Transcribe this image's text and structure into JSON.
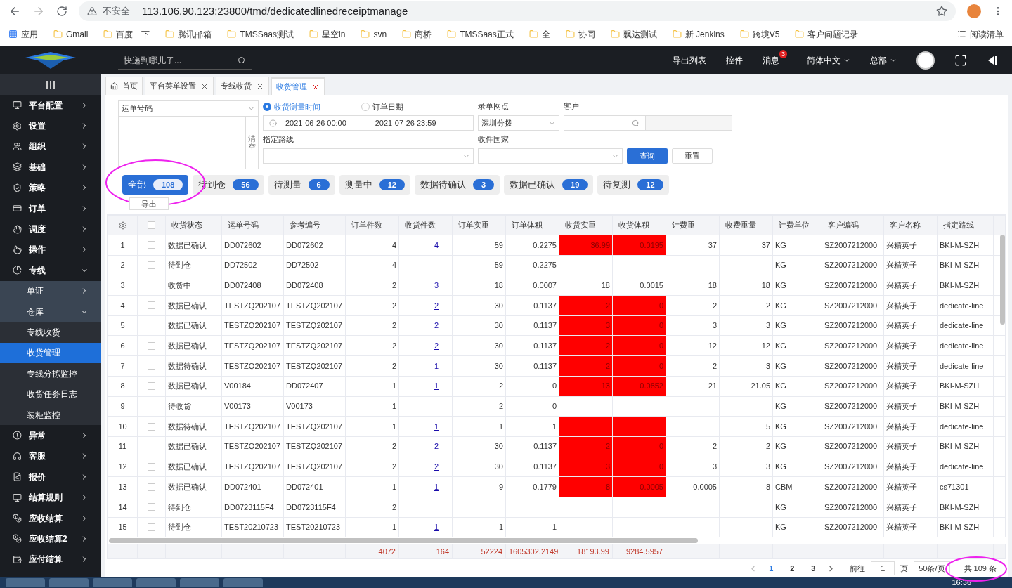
{
  "browser": {
    "security": "不安全",
    "url": "113.106.90.123:23800/tmd/dedicatedlinedreceiptmanage",
    "bookmarks": [
      "应用",
      "Gmail",
      "百度一下",
      "腾讯邮箱",
      "TMSSaas测试",
      "星空in",
      "svn",
      "商桥",
      "TMSSaas正式",
      "全",
      "协同",
      "飘达测试",
      "新 Jenkins",
      "跨境V5",
      "客户问题记录"
    ],
    "reading_list": "阅读清单"
  },
  "header": {
    "search_placeholder": "快递到哪儿了...",
    "actions": [
      "导出列表",
      "控件"
    ],
    "messages": "消息",
    "message_badge": "3",
    "language": "简体中文",
    "region": "总部"
  },
  "sidebar": {
    "items": [
      {
        "label": "平台配置",
        "expanded": false
      },
      {
        "label": "设置",
        "expanded": false
      },
      {
        "label": "组织",
        "expanded": false
      },
      {
        "label": "基础",
        "expanded": false
      },
      {
        "label": "策略",
        "expanded": false
      },
      {
        "label": "订单",
        "expanded": false
      },
      {
        "label": "调度",
        "expanded": false
      },
      {
        "label": "操作",
        "expanded": false
      },
      {
        "label": "专线",
        "expanded": true,
        "children": [
          {
            "label": "单证",
            "expanded": false
          },
          {
            "label": "仓库",
            "expanded": true,
            "children": [
              {
                "label": "专线收货",
                "selected": false
              },
              {
                "label": "收货管理",
                "selected": true
              },
              {
                "label": "专线分拣监控",
                "selected": false
              },
              {
                "label": "收货任务日志",
                "selected": false
              },
              {
                "label": "装柜监控",
                "selected": false
              }
            ]
          }
        ]
      },
      {
        "label": "异常",
        "expanded": false
      },
      {
        "label": "客服",
        "expanded": false
      },
      {
        "label": "报价",
        "expanded": false
      },
      {
        "label": "结算规则",
        "expanded": false
      },
      {
        "label": "应收结算",
        "expanded": false
      },
      {
        "label": "应收结算2",
        "expanded": false
      },
      {
        "label": "应付结算",
        "expanded": false
      }
    ]
  },
  "tabs": [
    {
      "label": "首页",
      "kind": "home",
      "selected": false
    },
    {
      "label": "平台菜单设置",
      "kind": "closable",
      "selected": false
    },
    {
      "label": "专线收货",
      "kind": "closable",
      "selected": false
    },
    {
      "label": "收货管理",
      "kind": "closable",
      "selected": true
    }
  ],
  "filters": {
    "number_type": "运单号码",
    "clear": "清空",
    "date_types": [
      {
        "label": "收货测量时间",
        "selected": true
      },
      {
        "label": "订单日期",
        "selected": false
      }
    ],
    "date_start": "2021-06-26 00:00",
    "date_separator": "-",
    "date_end": "2021-07-26 23:59",
    "site_label": "录单网点",
    "site_value": "深圳分拨",
    "customer_label": "客户",
    "route_label": "指定路线",
    "country_label": "收件国家",
    "search": "查询",
    "reset": "重置"
  },
  "status_tabs": [
    {
      "label": "全部",
      "count": "108",
      "selected": true
    },
    {
      "label": "待到仓",
      "count": "56",
      "selected": false
    },
    {
      "label": "待测量",
      "count": "6",
      "selected": false
    },
    {
      "label": "测量中",
      "count": "12",
      "selected": false
    },
    {
      "label": "数据待确认",
      "count": "3",
      "selected": false
    },
    {
      "label": "数据已确认",
      "count": "19",
      "selected": false
    },
    {
      "label": "待复测",
      "count": "12",
      "selected": false
    }
  ],
  "export": "导出",
  "table": {
    "select_all_checked": false,
    "columns": [
      {
        "label": "收货状态",
        "kind": "text"
      },
      {
        "label": "运单号码",
        "kind": "text"
      },
      {
        "label": "参考编号",
        "kind": "text"
      },
      {
        "label": "订单件数",
        "kind": "num",
        "total": "4072"
      },
      {
        "label": "收货件数",
        "kind": "link",
        "total": "164"
      },
      {
        "label": "订单实重",
        "kind": "num",
        "total": "52224"
      },
      {
        "label": "订单体积",
        "kind": "num",
        "total": "1605302.2149"
      },
      {
        "label": "收货实重",
        "kind": "alert",
        "total": "18193.99"
      },
      {
        "label": "收货体积",
        "kind": "alert",
        "total": "9284.5957"
      },
      {
        "label": "计费重",
        "kind": "num"
      },
      {
        "label": "收费重量",
        "kind": "num"
      },
      {
        "label": "计费单位",
        "kind": "text"
      },
      {
        "label": "客户编码",
        "kind": "text"
      },
      {
        "label": "客户名称",
        "kind": "text"
      },
      {
        "label": "指定路线",
        "kind": "text"
      }
    ],
    "rows": [
      {
        "no": "1",
        "checked": false,
        "alert": true,
        "cells": [
          "数据已确认",
          "DD072602",
          "DD072602",
          "4",
          "4",
          "59",
          "0.2275",
          "36.99",
          "0.0195",
          "37",
          "37",
          "KG",
          "SZ2007212000",
          "兴精英子",
          "BKI-M-SZH"
        ]
      },
      {
        "no": "2",
        "checked": false,
        "alert": false,
        "cells": [
          "待到仓",
          "DD72502",
          "DD72502",
          "4",
          null,
          "59",
          "0.2275",
          null,
          null,
          null,
          null,
          "KG",
          "SZ2007212000",
          "兴精英子",
          "BKI-M-SZH"
        ]
      },
      {
        "no": "3",
        "checked": false,
        "alert": false,
        "cells": [
          "收货中",
          "DD072408",
          "DD072408",
          "2",
          "3",
          "18",
          "0.0007",
          "18",
          "0.0015",
          "18",
          "18",
          "KG",
          "SZ2007212000",
          "兴精英子",
          "BKI-M-SZH"
        ]
      },
      {
        "no": "4",
        "checked": false,
        "alert": true,
        "cells": [
          "数据已确认",
          "TESTZQ202107",
          "TESTZQ202107",
          "2",
          "2",
          "30",
          "0.1137",
          "2",
          "0",
          "2",
          "2",
          "KG",
          "SZ2007212000",
          "兴精英子",
          "dedicate-line"
        ]
      },
      {
        "no": "5",
        "checked": false,
        "alert": true,
        "cells": [
          "数据已确认",
          "TESTZQ202107",
          "TESTZQ202107",
          "2",
          "2",
          "30",
          "0.1137",
          "3",
          "0",
          "3",
          "3",
          "KG",
          "SZ2007212000",
          "兴精英子",
          "dedicate-line"
        ]
      },
      {
        "no": "6",
        "checked": false,
        "alert": true,
        "cells": [
          "数据已确认",
          "TESTZQ202107",
          "TESTZQ202107",
          "2",
          "2",
          "30",
          "0.1137",
          "2",
          "0",
          "12",
          "12",
          "KG",
          "SZ2007212000",
          "兴精英子",
          "dedicate-line"
        ]
      },
      {
        "no": "7",
        "checked": false,
        "alert": true,
        "cells": [
          "数据待确认",
          "TESTZQ202107",
          "TESTZQ202107",
          "2",
          "1",
          "30",
          "0.1137",
          "2",
          "0",
          "2",
          "3",
          "KG",
          "SZ2007212000",
          "兴精英子",
          "dedicate-line"
        ]
      },
      {
        "no": "8",
        "checked": false,
        "alert": true,
        "cells": [
          "数据已确认",
          "V00184",
          "DD072407",
          "1",
          "1",
          "2",
          "0",
          "13",
          "0.0852",
          "21",
          "21.05",
          "KG",
          "SZ2007212000",
          "兴精英子",
          "BKI-M-SZH"
        ]
      },
      {
        "no": "9",
        "checked": false,
        "alert": false,
        "cells": [
          "待收货",
          "V00173",
          "V00173",
          "1",
          null,
          "2",
          "0",
          null,
          null,
          null,
          null,
          "KG",
          "SZ2007212000",
          "兴精英子",
          "BKI-M-SZH"
        ]
      },
      {
        "no": "10",
        "checked": false,
        "alert": true,
        "cells": [
          "数据待确认",
          "TESTZQ202107",
          "TESTZQ202107",
          "1",
          "1",
          "1",
          "1",
          null,
          null,
          null,
          "5",
          "KG",
          "SZ2007212000",
          "兴精英子",
          "dedicate-line"
        ]
      },
      {
        "no": "11",
        "checked": false,
        "alert": true,
        "cells": [
          "数据已确认",
          "TESTZQ202107",
          "TESTZQ202107",
          "2",
          "2",
          "30",
          "0.1137",
          "2",
          "0",
          "2",
          "2",
          "KG",
          "SZ2007212000",
          "兴精英子",
          "BKI-M-SZH"
        ]
      },
      {
        "no": "12",
        "checked": false,
        "alert": true,
        "cells": [
          "数据已确认",
          "TESTZQ202107",
          "TESTZQ202107",
          "2",
          "2",
          "30",
          "0.1137",
          "3",
          "0",
          "3",
          "3",
          "KG",
          "SZ2007212000",
          "兴精英子",
          "dedicate-line"
        ]
      },
      {
        "no": "13",
        "checked": false,
        "alert": true,
        "cells": [
          "数据已确认",
          "DD072401",
          "DD072401",
          "1",
          "1",
          "9",
          "0.1779",
          "8",
          "0.0005",
          "0.0005",
          "8",
          "CBM",
          "SZ2007212000",
          "兴精英子",
          "cs71301"
        ]
      },
      {
        "no": "14",
        "checked": false,
        "alert": false,
        "cells": [
          "待到仓",
          "DD0723115F4",
          "DD0723115F4",
          "2",
          null,
          null,
          null,
          null,
          null,
          null,
          null,
          "KG",
          "SZ2007212000",
          "兴精英子",
          "BKI-M-SZH"
        ]
      },
      {
        "no": "15",
        "checked": false,
        "alert": false,
        "cells": [
          "待到仓",
          "TEST20210723",
          "TEST20210723",
          "1",
          "1",
          "1",
          "1",
          null,
          null,
          null,
          null,
          "KG",
          "SZ2007212000",
          "兴精英子",
          "BKI-M-SZH"
        ]
      }
    ]
  },
  "pagination": {
    "pages": [
      {
        "label": "1",
        "selected": true
      },
      {
        "label": "2",
        "selected": false
      },
      {
        "label": "3",
        "selected": false
      }
    ],
    "goto_label": "前往",
    "goto_value": "1",
    "page_unit": "页",
    "page_size": "50条/页",
    "total": "共 109 条"
  },
  "taskbar": {
    "clock": "16:36"
  }
}
